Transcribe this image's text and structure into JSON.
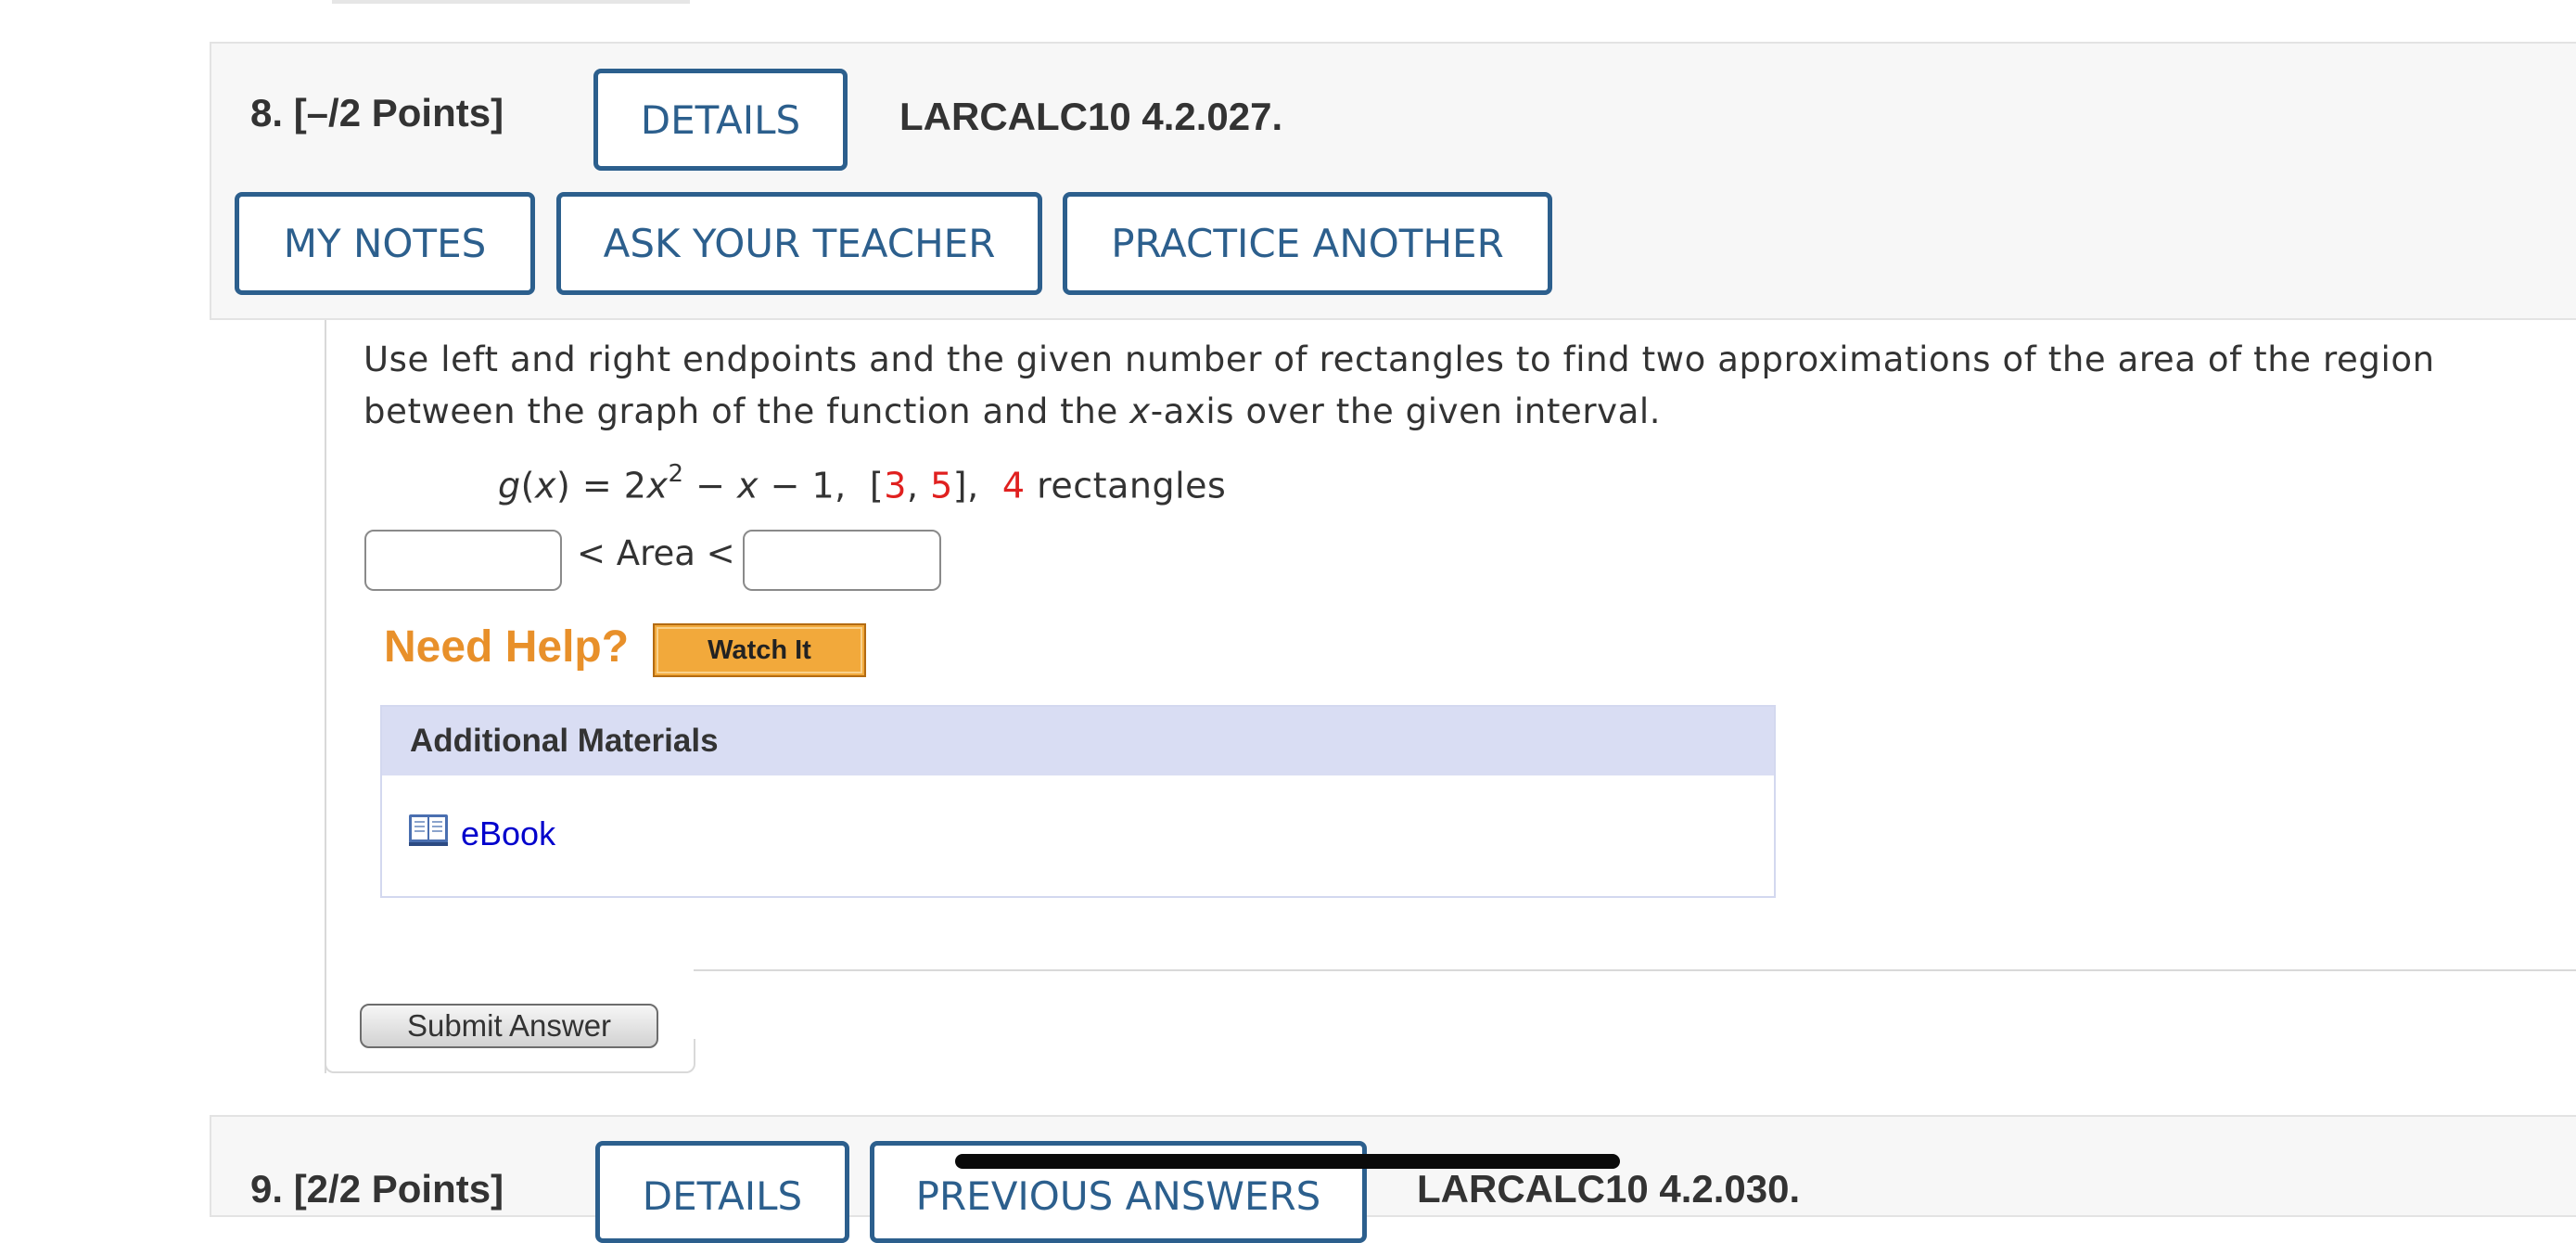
{
  "question8": {
    "number_points": "8.  [–/2 Points]",
    "details_label": "DETAILS",
    "reference": "LARCALC10 4.2.027.",
    "my_notes_label": "MY NOTES",
    "ask_teacher_label": "ASK YOUR TEACHER",
    "practice_another_label": "PRACTICE ANOTHER",
    "prompt_part1": "Use left and right endpoints and the given number of rectangles to find two approximations of the area of the region between the graph of the function and the ",
    "prompt_var": "x",
    "prompt_part2": "-axis over the given interval.",
    "formula": {
      "fn_name": "g",
      "var": "x",
      "lhs_open": "(",
      "lhs_close": ") = 2",
      "exponent": "2",
      "minus_part": " − ",
      "minus_tail": " − 1,  [",
      "interval_start": "3",
      "comma": ", ",
      "interval_end": "5",
      "close": "],  ",
      "rect_count": "4",
      "rect_label": " rectangles"
    },
    "area_label": "< Area <",
    "lower_bound_value": "",
    "upper_bound_value": "",
    "need_help_label": "Need Help?",
    "watch_it_label": "Watch It",
    "additional_materials_label": "Additional Materials",
    "ebook_label": "eBook",
    "submit_label": "Submit Answer"
  },
  "question9": {
    "number_points": "9.  [2/2 Points]",
    "details_label": "DETAILS",
    "previous_answers_label": "PREVIOUS ANSWERS",
    "reference": "LARCALC10 4.2.030."
  },
  "colors": {
    "accent": "#2c5f8d",
    "highlight_red": "#e0201f",
    "help_orange": "#e8902a",
    "link_blue": "#0000cc"
  },
  "icons": {
    "ebook": "book-icon"
  }
}
